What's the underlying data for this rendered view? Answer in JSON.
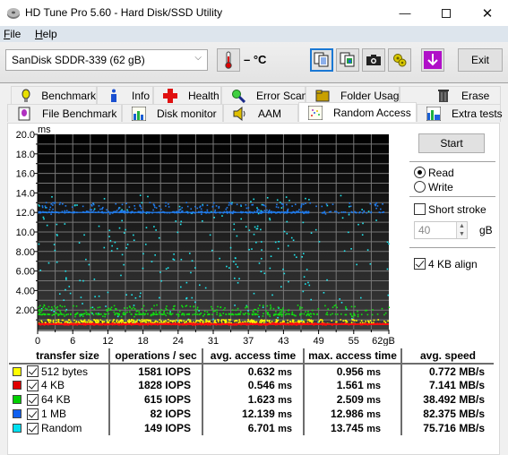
{
  "window": {
    "title": "HD Tune Pro 5.60 - Hard Disk/SSD Utility",
    "controls": {
      "minimize": "—",
      "maximize": "☐",
      "close": "✕"
    }
  },
  "menu": [
    {
      "label": "File",
      "accel": "F",
      "rest": "ile"
    },
    {
      "label": "Help",
      "accel": "H",
      "rest": "elp"
    }
  ],
  "toolbar": {
    "drive": "SanDisk SDDR-339 (62 gB)",
    "temperature": "– °C",
    "buttons": [
      "copy-text-icon",
      "copy-image-icon",
      "camera-icon",
      "options-icon",
      "save-down-icon"
    ],
    "exit_label": "Exit"
  },
  "tabs_row1": [
    {
      "label": "Benchmark",
      "icon": "lightbulb-icon"
    },
    {
      "label": "Info",
      "icon": "info-icon"
    },
    {
      "label": "Health",
      "icon": "health-cross-icon"
    },
    {
      "label": "Error Scan",
      "icon": "magnifier-icon"
    },
    {
      "label": "Folder Usage",
      "icon": "folder-icon"
    },
    {
      "label": "Erase",
      "icon": "trash-icon"
    }
  ],
  "tabs_row2": [
    {
      "label": "File Benchmark",
      "icon": "file-benchmark-icon"
    },
    {
      "label": "Disk monitor",
      "icon": "bar-chart-icon"
    },
    {
      "label": "AAM",
      "icon": "speaker-icon"
    },
    {
      "label": "Random Access",
      "icon": "scatter-icon",
      "active": true
    },
    {
      "label": "Extra tests",
      "icon": "extra-tests-icon"
    }
  ],
  "controls": {
    "start_label": "Start",
    "read_label": "Read",
    "write_label": "Write",
    "mode": "Read",
    "short_stroke_label": "Short stroke",
    "short_stroke_checked": false,
    "short_stroke_value": "40",
    "short_stroke_unit": "gB",
    "align_label": "4 KB align",
    "align_checked": true
  },
  "results": {
    "headers": [
      "transfer size",
      "operations / sec",
      "avg. access time",
      "max. access time",
      "avg. speed"
    ],
    "rows": [
      {
        "color": "#ffff00",
        "checked": true,
        "size": "512 bytes",
        "ops": "1581 IOPS",
        "avg": "0.632",
        "max": "0.956",
        "speed": "0.772 MB/s"
      },
      {
        "color": "#e00000",
        "checked": true,
        "size": "4 KB",
        "ops": "1828 IOPS",
        "avg": "0.546",
        "max": "1.561",
        "speed": "7.141 MB/s"
      },
      {
        "color": "#00d000",
        "checked": true,
        "size": "64 KB",
        "ops": "615 IOPS",
        "avg": "1.623",
        "max": "2.509",
        "speed": "38.492 MB/s"
      },
      {
        "color": "#1060f0",
        "checked": true,
        "size": "1 MB",
        "ops": "82 IOPS",
        "avg": "12.139",
        "max": "12.986",
        "speed": "82.375 MB/s"
      },
      {
        "color": "#00e0f0",
        "checked": true,
        "size": "Random",
        "ops": "149 IOPS",
        "avg": "6.701",
        "max": "13.745",
        "speed": "75.716 MB/s"
      }
    ],
    "ms_unit": "ms"
  },
  "chart_data": {
    "type": "scatter",
    "title": "",
    "ylabel": "ms",
    "xlabel": "gB",
    "ylim": [
      0,
      20
    ],
    "xlim": [
      0,
      62
    ],
    "yticks": [
      "20.0",
      "18.0",
      "16.0",
      "14.0",
      "12.0",
      "10.0",
      "8.00",
      "6.00",
      "4.00",
      "2.00"
    ],
    "ytick_values": [
      20,
      18,
      16,
      14,
      12,
      10,
      8,
      6,
      4,
      2
    ],
    "xticks": [
      "0",
      "6",
      "12",
      "18",
      "24",
      "31",
      "37",
      "43",
      "49",
      "55",
      "62gB"
    ],
    "xtick_values": [
      0,
      6.2,
      12.4,
      18.6,
      24.8,
      31,
      37.2,
      43.4,
      49.6,
      55.8,
      62
    ],
    "grid": true,
    "series": [
      {
        "name": "512 bytes",
        "color": "#ffff00",
        "band": [
          0.5,
          1.0
        ],
        "density": 0.95
      },
      {
        "name": "4 KB",
        "color": "#ff1010",
        "band": [
          0.45,
          0.65
        ],
        "density": 0.9
      },
      {
        "name": "64 KB",
        "color": "#10e010",
        "band": [
          1.3,
          2.5
        ],
        "density": 0.8
      },
      {
        "name": "1 MB",
        "color": "#1f7cf0",
        "band": [
          11.8,
          13.0
        ],
        "density": 0.75
      },
      {
        "name": "Random",
        "color": "#20e8f0",
        "band": [
          0.6,
          13.8
        ],
        "density": 0.6
      }
    ]
  }
}
